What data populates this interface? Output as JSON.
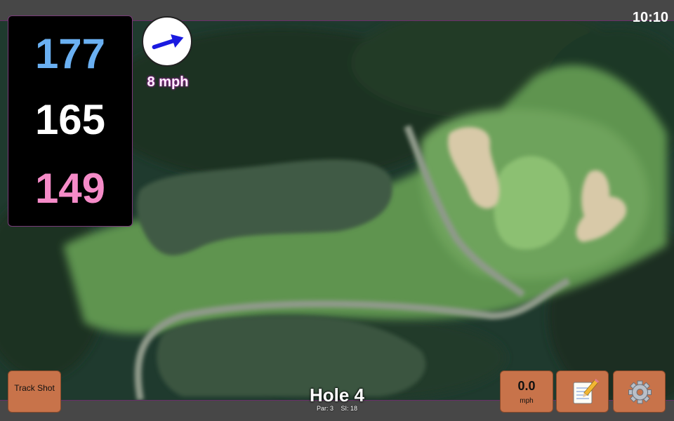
{
  "status_bar": {
    "time": "10:10"
  },
  "yardages": {
    "back": "177",
    "middle": "165",
    "front": "149"
  },
  "wind": {
    "speed_label": "8 mph",
    "direction_icon": "wind-arrow-icon"
  },
  "buttons": {
    "track_shot": "Track Shot",
    "speed_value": "0.0",
    "speed_unit": "mph",
    "notes_icon": "notepad-icon",
    "settings_icon": "gear-icon"
  },
  "hole": {
    "title": "Hole 4",
    "par": "Par: 3",
    "stroke_index": "SI: 18"
  },
  "colors": {
    "back": "#6ab0f2",
    "middle": "#ffffff",
    "front": "#f58bc8",
    "button": "#c8734a"
  }
}
